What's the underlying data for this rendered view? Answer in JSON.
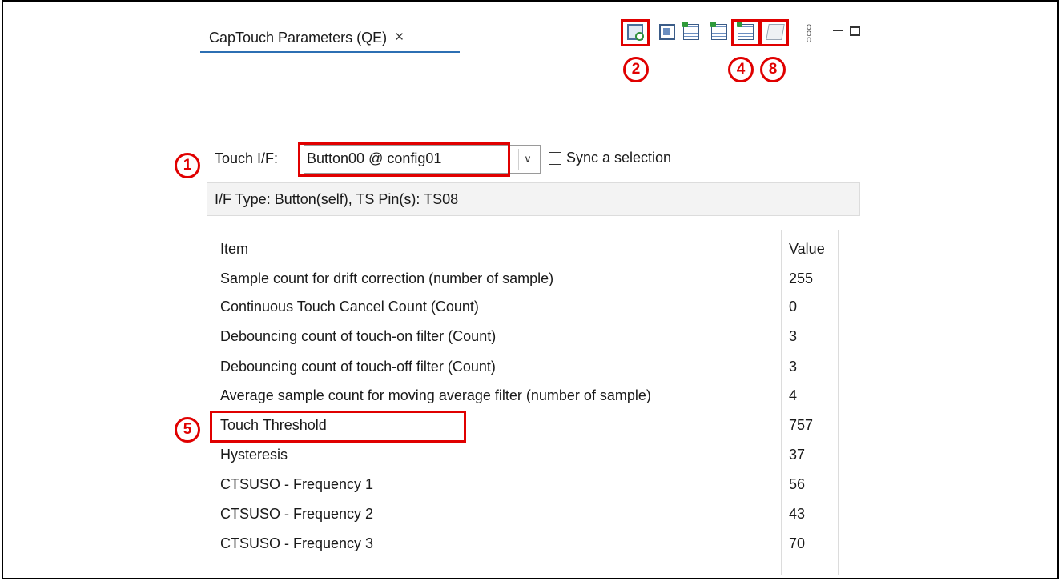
{
  "tab": {
    "title": "CapTouch Parameters (QE)",
    "close": "×"
  },
  "toolbar": {
    "icons": [
      "refresh-board-icon",
      "view-icon",
      "import-icon",
      "export-icon",
      "write-to-board-icon",
      "edit-icon"
    ],
    "more": "⋮"
  },
  "callouts": [
    "1",
    "2",
    "4",
    "5",
    "8"
  ],
  "touch_if": {
    "label": "Touch I/F:",
    "selected": "Button00 @ config01",
    "sync_label": "Sync a selection",
    "sync_checked": false
  },
  "info": "I/F Type: Button(self), TS Pin(s): TS08",
  "table": {
    "headers": [
      "Item",
      "Value"
    ],
    "rows": [
      {
        "item": "Sample count for drift correction (number of sample)",
        "value": "255"
      },
      {
        "item": "Continuous Touch Cancel Count (Count)",
        "value": "0"
      },
      {
        "item": "Debouncing count of touch-on filter (Count)",
        "value": "3"
      },
      {
        "item": "Debouncing count of touch-off filter (Count)",
        "value": "3"
      },
      {
        "item": "Average sample count for moving average filter (number of sample)",
        "value": "4"
      },
      {
        "item": "Touch Threshold",
        "value": "757"
      },
      {
        "item": "Hysteresis",
        "value": "37"
      },
      {
        "item": "CTSUSO - Frequency 1",
        "value": "56"
      },
      {
        "item": "CTSUSO - Frequency 2",
        "value": "43"
      },
      {
        "item": "CTSUSO - Frequency 3",
        "value": "70"
      }
    ]
  },
  "colors": {
    "highlight": "#e00000",
    "tab_underline": "#2c6fb3"
  }
}
